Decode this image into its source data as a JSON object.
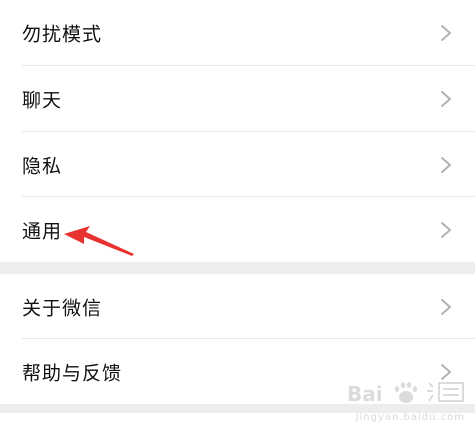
{
  "settings": {
    "group1": [
      {
        "label": "勿扰模式",
        "icon": "chevron-right-icon"
      },
      {
        "label": "聊天",
        "icon": "chevron-right-icon"
      },
      {
        "label": "隐私",
        "icon": "chevron-right-icon"
      },
      {
        "label": "通用",
        "icon": "chevron-right-icon"
      }
    ],
    "group2": [
      {
        "label": "关于微信",
        "icon": "chevron-right-icon"
      },
      {
        "label": "帮助与反馈",
        "icon": "chevron-right-icon"
      }
    ]
  },
  "annotation": {
    "icon": "red-arrow-icon",
    "color": "#e8322f"
  },
  "watermark": {
    "brand": "Baidu",
    "subtext": "jingyan.baidu.com"
  },
  "colors": {
    "background": "#ededed",
    "row": "#ffffff",
    "text": "#111111",
    "chevron": "#b2b2b2",
    "divider": "#e6e6e6"
  }
}
